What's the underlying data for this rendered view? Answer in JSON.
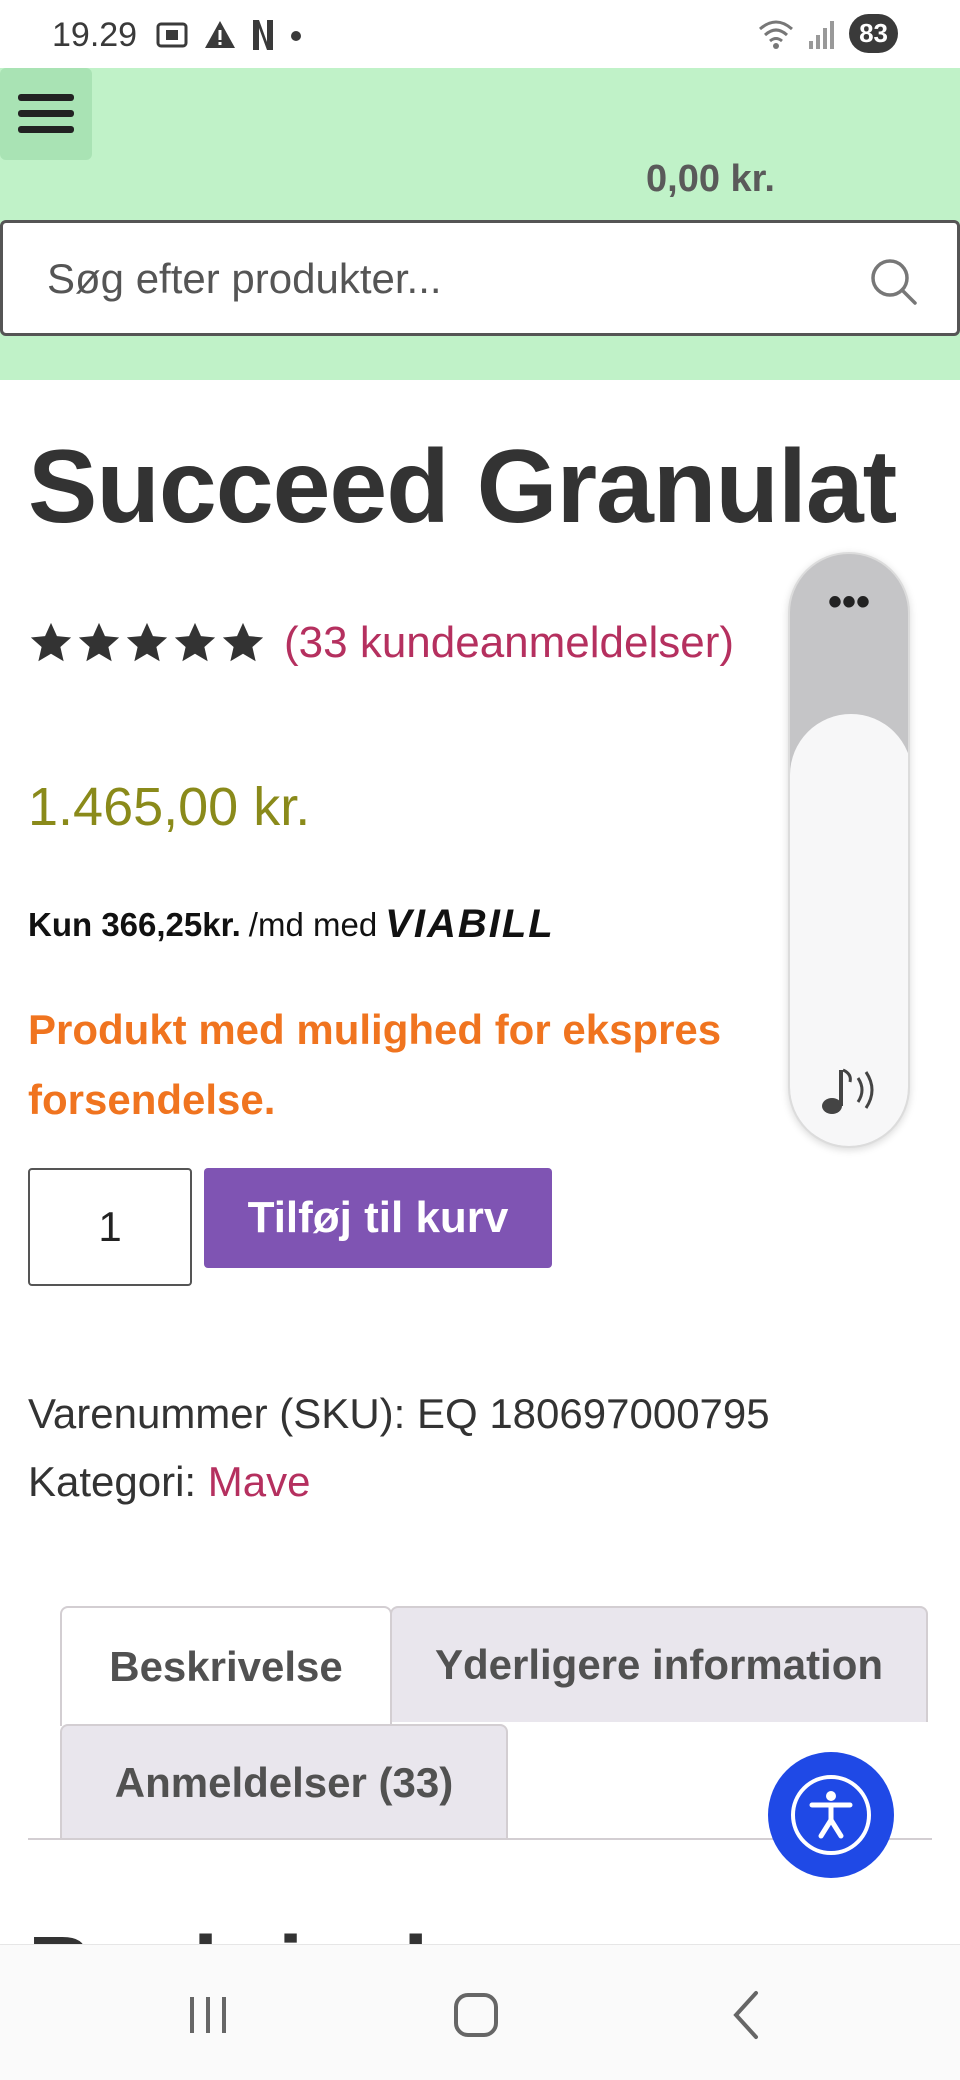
{
  "status_bar": {
    "time": "19.29",
    "battery": "83"
  },
  "header": {
    "cart_total": "0,00 kr.",
    "search_placeholder": "Søg efter produkter..."
  },
  "product": {
    "title": "Succeed Granulat",
    "rating_stars": 5,
    "reviews_link": "(33 kundeanmeldelser)",
    "price": "1.465,00 kr.",
    "viabill": {
      "amount": "Kun 366,25kr.",
      "suffix": "/md med",
      "logo": "VIABILL"
    },
    "express_notice": "Produkt med mulighed for ekspres forsendelse.",
    "quantity": "1",
    "add_to_cart_label": "Tilføj til kurv",
    "sku_label": "Varenummer (SKU): EQ 180697000795",
    "category_label": "Kategori:",
    "category_value": "Mave"
  },
  "tabs": [
    {
      "label": "Beskrivelse",
      "active": true
    },
    {
      "label": "Yderligere information",
      "active": false
    },
    {
      "label": "Anmeldelser (33)",
      "active": false
    }
  ],
  "section_heading": "Beskrivelse",
  "colors": {
    "header_bg": "#c0f2c8",
    "accent_purple": "#7f54b3",
    "link_pink": "#b5305f",
    "price_olive": "#8a8a1a",
    "express_orange": "#f0741f",
    "a11y_blue": "#1f49e6"
  },
  "icons": {
    "menu": "hamburger-icon",
    "search": "search-icon",
    "sound": "sound-icon",
    "more": "more-dots-icon",
    "accessibility": "accessibility-icon",
    "nav_recents": "recents-icon",
    "nav_home": "home-icon",
    "nav_back": "back-icon"
  }
}
